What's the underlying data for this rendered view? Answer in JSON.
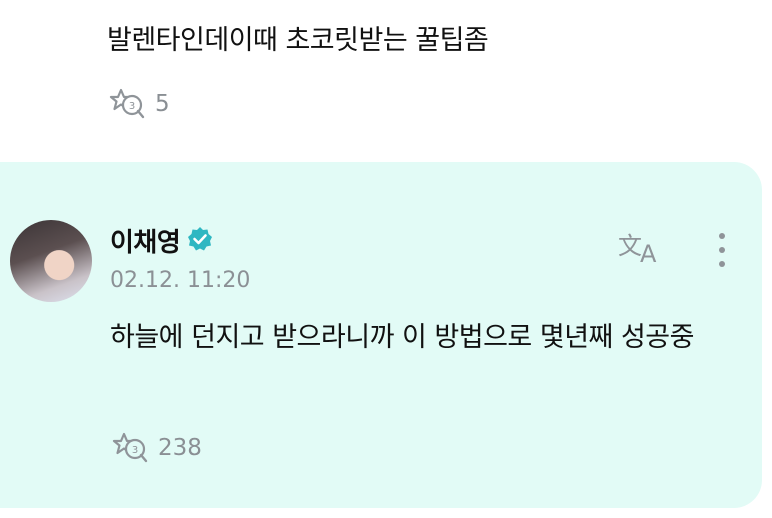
{
  "post": {
    "text": "발렌타인데이때 초코릿받는 꿀팁좀",
    "reaction_icon": "reaction-icon",
    "reaction_count": "5"
  },
  "comment": {
    "author": "이채영",
    "verified_icon": "verified-badge-icon",
    "timestamp": "02.12. 11:20",
    "translate_icon": "translate-icon",
    "more_icon": "more-vertical-icon",
    "text": "하늘에 던지고 받으라니까 이 방법으로 몇년째 성공중",
    "reaction_icon": "reaction-icon",
    "reaction_count": "238"
  },
  "colors": {
    "card_background": "#e2fbf6",
    "verified": "#2fb7c2",
    "muted_text": "#8b9095"
  }
}
